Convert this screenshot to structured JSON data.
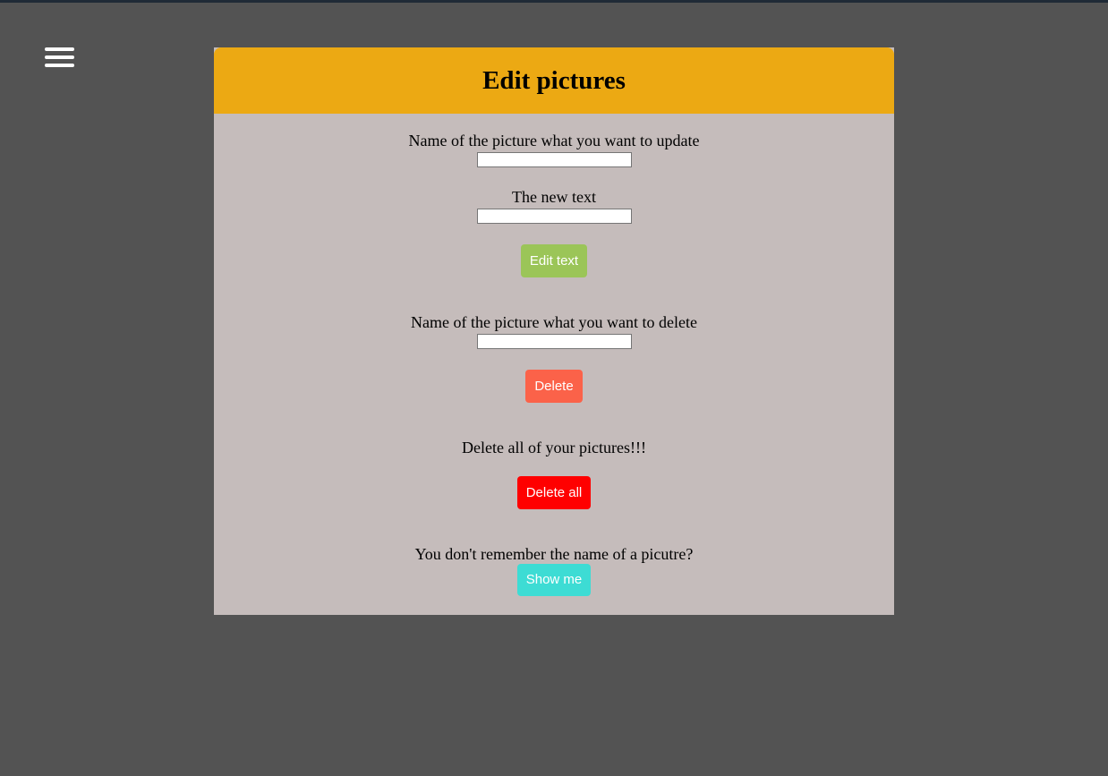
{
  "menu": {
    "icon": "hamburger-menu-icon"
  },
  "card": {
    "title": "Edit pictures",
    "update_name_label": "Name of the picture what you want to update",
    "update_name_value": "",
    "new_text_label": "The new text",
    "new_text_value": "",
    "edit_button_label": "Edit text",
    "delete_name_label": "Name of the picture what you want to delete",
    "delete_name_value": "",
    "delete_button_label": "Delete",
    "delete_all_label": "Delete all of your pictures!!!",
    "delete_all_button_label": "Delete all",
    "remember_label": "You don't remember the name of a picutre?",
    "show_me_button_label": "Show me"
  },
  "colors": {
    "page_background": "#535353",
    "header": "#eca913",
    "card_body": "#c5bcbb",
    "edit_button": "#9bc558",
    "delete_button": "#fb6249",
    "delete_all_button": "#ff0000",
    "show_me_button": "#3ddcd4"
  }
}
